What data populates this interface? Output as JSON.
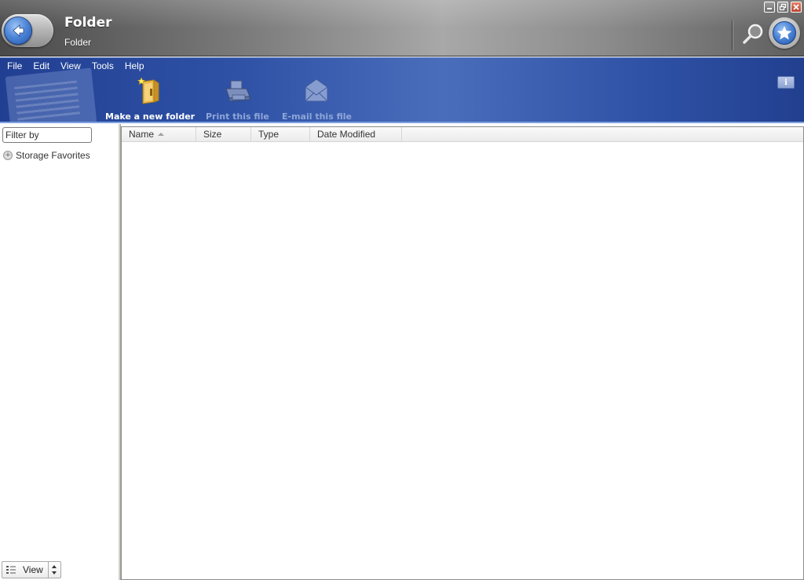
{
  "window": {
    "title": "Folder",
    "subtitle": "Folder"
  },
  "titlebar": {
    "back_icon": "back-arrow-icon",
    "search_icon": "magnifier-icon",
    "favorites_icon": "star-icon",
    "window_controls": [
      "minimize",
      "restore",
      "close"
    ]
  },
  "menu": {
    "items": [
      "File",
      "Edit",
      "View",
      "Tools",
      "Help"
    ]
  },
  "toolbar": {
    "tools": [
      {
        "label": "Make a new folder",
        "icon": "new-folder-icon",
        "enabled": true
      },
      {
        "label": "Print this file",
        "icon": "printer-icon",
        "enabled": false
      },
      {
        "label": "E-mail this file",
        "icon": "envelope-icon",
        "enabled": false
      }
    ],
    "info_icon": "info-icon"
  },
  "sidebar": {
    "filter_placeholder": "Filter by",
    "tree": [
      {
        "label": "Storage Favorites",
        "expanded": false
      }
    ],
    "view_label": "View"
  },
  "list": {
    "columns": [
      "Name",
      "Size",
      "Type",
      "Date Modified"
    ],
    "sort_column": "Name",
    "sort_direction": "ascending",
    "rows": []
  },
  "colors": {
    "ribbon_blue": "#2f52a6",
    "titlebar_gray": "#8c8c8c",
    "accent_blue": "#4d86d8",
    "close_red": "#c23c1e"
  }
}
